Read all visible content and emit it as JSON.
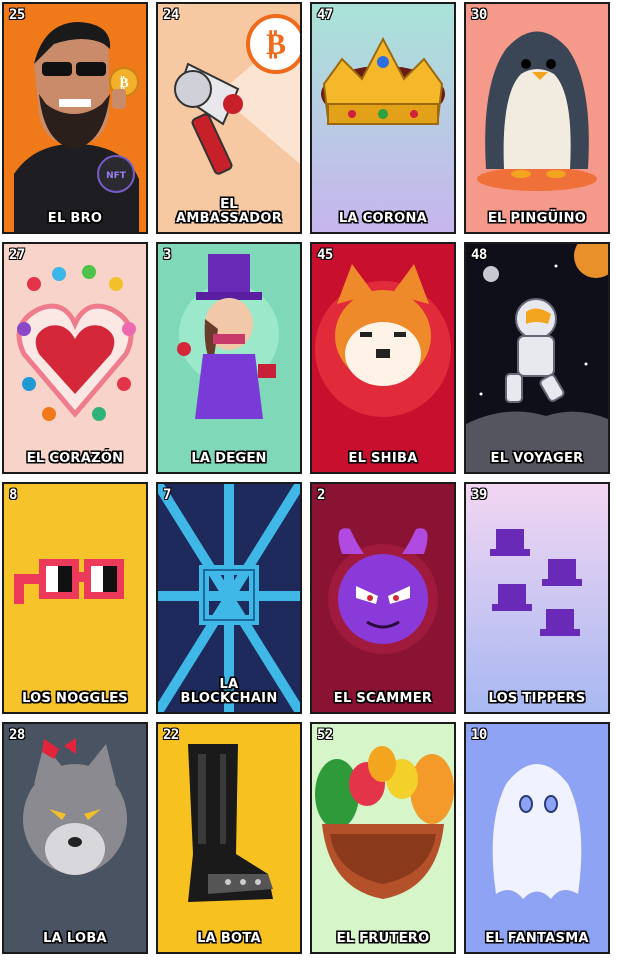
{
  "cards": [
    {
      "number": "25",
      "title": "EL BRO",
      "bg": "#f07a1a"
    },
    {
      "number": "24",
      "title": "EL\nAMBASSADOR",
      "bg": "#f6c9a3"
    },
    {
      "number": "47",
      "title": "LA CORONA",
      "bg": "#a9e3d8"
    },
    {
      "number": "30",
      "title": "EL PINGÜINO",
      "bg": "#f59a8a"
    },
    {
      "number": "27",
      "title": "EL CORAZÓN",
      "bg": "#f7d3c9"
    },
    {
      "number": "3",
      "title": "LA DEGEN",
      "bg": "#7fd9b8"
    },
    {
      "number": "45",
      "title": "EL SHIBA",
      "bg": "#c8102e"
    },
    {
      "number": "48",
      "title": "EL VOYAGER",
      "bg": "#0f0f1a"
    },
    {
      "number": "8",
      "title": "LOS NOGGLES",
      "bg": "#f6c42a"
    },
    {
      "number": "7",
      "title": "LA\nBLOCKCHAIN",
      "bg": "#2a3b7a"
    },
    {
      "number": "2",
      "title": "EL SCAMMER",
      "bg": "#8a1233"
    },
    {
      "number": "39",
      "title": "LOS TIPPERS",
      "bg": "#d9c7f2"
    },
    {
      "number": "28",
      "title": "LA LOBA",
      "bg": "#4a5362"
    },
    {
      "number": "22",
      "title": "LA BOTA",
      "bg": "#f7c21f"
    },
    {
      "number": "52",
      "title": "EL FRUTERO",
      "bg": "#d6f5c8"
    },
    {
      "number": "10",
      "title": "EL FANTASMA",
      "bg": "#8fa3f5"
    }
  ]
}
